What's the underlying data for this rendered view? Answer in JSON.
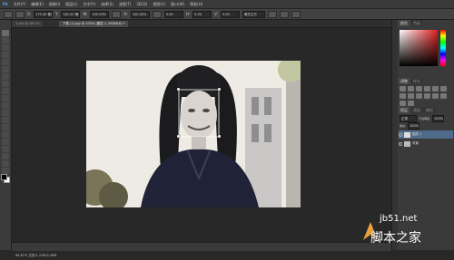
{
  "menubar": {
    "items": [
      "PS",
      "文件(F)",
      "编辑(E)",
      "图像(I)",
      "图层(L)",
      "文字(Y)",
      "选择(S)",
      "滤镜(T)",
      "3D(D)",
      "视图(V)",
      "窗口(W)",
      "帮助(H)"
    ]
  },
  "options": {
    "x_label": "X:",
    "x_value": "175.50 像素",
    "y_label": "Y:",
    "y_value": "161.00 像素",
    "w_label": "W:",
    "w_value": "100.00%",
    "h_label": "H:",
    "h_value": "100.00%",
    "angle_value": "0.00",
    "h2_label": "H:",
    "h2_value": "0.00",
    "v_label": "V:",
    "v_value": "0.00",
    "interp_value": "两次立方"
  },
  "tabs": [
    {
      "label": "1.psd @ 66.7%"
    },
    {
      "label": "下载 (1).jpg @ 100% (图层 1, RGB/8#) *"
    }
  ],
  "status": {
    "text": "66.67%   文档:1.23M/2.46M"
  },
  "panels": {
    "color_tab": "颜色",
    "swatches_tab": "色板",
    "adjust_tab": "调整",
    "styles_tab": "样式",
    "layers_tab": "图层",
    "channels_tab": "通道",
    "paths_tab": "路径",
    "blend_mode": "正常",
    "opacity_label": "不透明度:",
    "opacity_value": "100%",
    "fill_label": "填充:",
    "fill_value": "100%",
    "layers": [
      {
        "name": "图层 1"
      },
      {
        "name": "背景"
      }
    ]
  },
  "watermark": {
    "url": "jb51.net",
    "brand": "脚本之家"
  },
  "colors": {
    "foreground": "#000000",
    "background": "#ffffff"
  }
}
